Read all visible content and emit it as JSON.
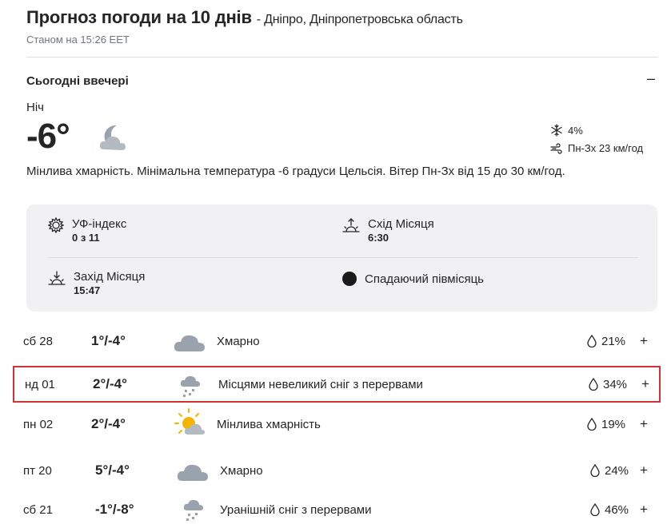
{
  "header": {
    "title": "Прогноз погоди на 10 днів",
    "location": "- Дніпро, Дніпропетровська область",
    "as_of": "Станом на 15:26 EET"
  },
  "today": {
    "section_title": "Сьогодні ввечері",
    "collapse_label": "–",
    "period": "Ніч",
    "temp": "-6°",
    "precip": "4%",
    "wind": "Пн-Зх 23 км/год",
    "description": "Мінлива хмарність. Мінімальна температура -6 градуси Цельсія. Вітер Пн-Зх від 15 до 30 км/год.",
    "details": {
      "uv_label": "УФ-індекс",
      "uv_value": "0 з 11",
      "moonrise_label": "Схід Місяця",
      "moonrise_value": "6:30",
      "moonset_label": "Захід Місяця",
      "moonset_value": "15:47",
      "moon_phase": "Спадаючий півмісяць"
    }
  },
  "days": [
    {
      "name": "сб 28",
      "temp": "1°/-4°",
      "desc": "Хмарно",
      "precip": "21%",
      "icon": "cloudy-icon"
    },
    {
      "name": "нд 01",
      "temp": "2°/-4°",
      "desc": "Місцями невеликий сніг з перервами",
      "precip": "34%",
      "icon": "snow-icon"
    },
    {
      "name": "пн 02",
      "temp": "2°/-4°",
      "desc": "Мінлива хмарність",
      "precip": "19%",
      "icon": "partly-cloudy-icon"
    },
    {
      "name": "пт 20",
      "temp": "5°/-4°",
      "desc": "Хмарно",
      "precip": "24%",
      "icon": "cloudy-icon"
    },
    {
      "name": "сб 21",
      "temp": "-1°/-8°",
      "desc": "Уранішній сніг з перервами",
      "precip": "46%",
      "icon": "snow-icon"
    }
  ],
  "expand_label": "+",
  "colors": {
    "accent_highlight": "#d2303a",
    "card_bg": "#f1f1f3",
    "cloud": "#9aa3ad",
    "sun": "#f4b400"
  }
}
